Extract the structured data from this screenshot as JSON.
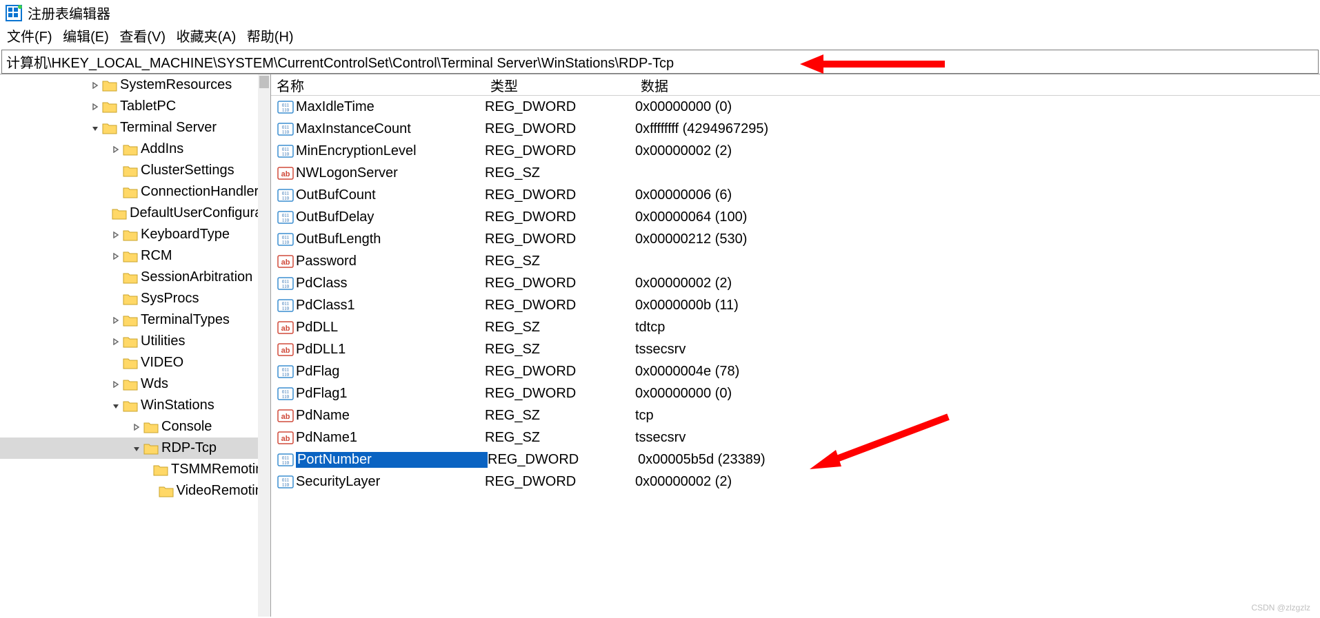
{
  "title": "注册表编辑器",
  "menu": {
    "file": "文件(F)",
    "edit": "编辑(E)",
    "view": "查看(V)",
    "fav": "收藏夹(A)",
    "help": "帮助(H)"
  },
  "address": "计算机\\HKEY_LOCAL_MACHINE\\SYSTEM\\CurrentControlSet\\Control\\Terminal Server\\WinStations\\RDP-Tcp",
  "tree": [
    {
      "indent": 130,
      "chev": "closed",
      "label": "SystemResources"
    },
    {
      "indent": 130,
      "chev": "closed",
      "label": "TabletPC"
    },
    {
      "indent": 130,
      "chev": "open",
      "label": "Terminal Server"
    },
    {
      "indent": 160,
      "chev": "closed",
      "label": "AddIns"
    },
    {
      "indent": 160,
      "chev": "none",
      "label": "ClusterSettings"
    },
    {
      "indent": 160,
      "chev": "none",
      "label": "ConnectionHandler"
    },
    {
      "indent": 160,
      "chev": "none",
      "label": "DefaultUserConfiguration"
    },
    {
      "indent": 160,
      "chev": "closed",
      "label": "KeyboardType"
    },
    {
      "indent": 160,
      "chev": "closed",
      "label": "RCM"
    },
    {
      "indent": 160,
      "chev": "none",
      "label": "SessionArbitration"
    },
    {
      "indent": 160,
      "chev": "none",
      "label": "SysProcs"
    },
    {
      "indent": 160,
      "chev": "closed",
      "label": "TerminalTypes"
    },
    {
      "indent": 160,
      "chev": "closed",
      "label": "Utilities"
    },
    {
      "indent": 160,
      "chev": "none",
      "label": "VIDEO"
    },
    {
      "indent": 160,
      "chev": "closed",
      "label": "Wds"
    },
    {
      "indent": 160,
      "chev": "open",
      "label": "WinStations"
    },
    {
      "indent": 190,
      "chev": "closed",
      "label": "Console"
    },
    {
      "indent": 190,
      "chev": "open",
      "label": "RDP-Tcp",
      "selected": true
    },
    {
      "indent": 220,
      "chev": "none",
      "label": "TSMMRemoting"
    },
    {
      "indent": 220,
      "chev": "none",
      "label": "VideoRemoting"
    }
  ],
  "columns": {
    "name": "名称",
    "type": "类型",
    "data": "数据"
  },
  "values": [
    {
      "icon": "dword",
      "name": "MaxIdleTime",
      "type": "REG_DWORD",
      "data": "0x00000000 (0)"
    },
    {
      "icon": "dword",
      "name": "MaxInstanceCount",
      "type": "REG_DWORD",
      "data": "0xffffffff (4294967295)"
    },
    {
      "icon": "dword",
      "name": "MinEncryptionLevel",
      "type": "REG_DWORD",
      "data": "0x00000002 (2)"
    },
    {
      "icon": "sz",
      "name": "NWLogonServer",
      "type": "REG_SZ",
      "data": ""
    },
    {
      "icon": "dword",
      "name": "OutBufCount",
      "type": "REG_DWORD",
      "data": "0x00000006 (6)"
    },
    {
      "icon": "dword",
      "name": "OutBufDelay",
      "type": "REG_DWORD",
      "data": "0x00000064 (100)"
    },
    {
      "icon": "dword",
      "name": "OutBufLength",
      "type": "REG_DWORD",
      "data": "0x00000212 (530)"
    },
    {
      "icon": "sz",
      "name": "Password",
      "type": "REG_SZ",
      "data": ""
    },
    {
      "icon": "dword",
      "name": "PdClass",
      "type": "REG_DWORD",
      "data": "0x00000002 (2)"
    },
    {
      "icon": "dword",
      "name": "PdClass1",
      "type": "REG_DWORD",
      "data": "0x0000000b (11)"
    },
    {
      "icon": "sz",
      "name": "PdDLL",
      "type": "REG_SZ",
      "data": "tdtcp"
    },
    {
      "icon": "sz",
      "name": "PdDLL1",
      "type": "REG_SZ",
      "data": "tssecsrv"
    },
    {
      "icon": "dword",
      "name": "PdFlag",
      "type": "REG_DWORD",
      "data": "0x0000004e (78)"
    },
    {
      "icon": "dword",
      "name": "PdFlag1",
      "type": "REG_DWORD",
      "data": "0x00000000 (0)"
    },
    {
      "icon": "sz",
      "name": "PdName",
      "type": "REG_SZ",
      "data": "tcp"
    },
    {
      "icon": "sz",
      "name": "PdName1",
      "type": "REG_SZ",
      "data": "tssecsrv"
    },
    {
      "icon": "dword",
      "name": "PortNumber",
      "type": "REG_DWORD",
      "data": "0x00005b5d (23389)",
      "selected": true
    },
    {
      "icon": "dword",
      "name": "SecurityLayer",
      "type": "REG_DWORD",
      "data": "0x00000002 (2)"
    }
  ],
  "watermark": "CSDN @zlzgzlz"
}
